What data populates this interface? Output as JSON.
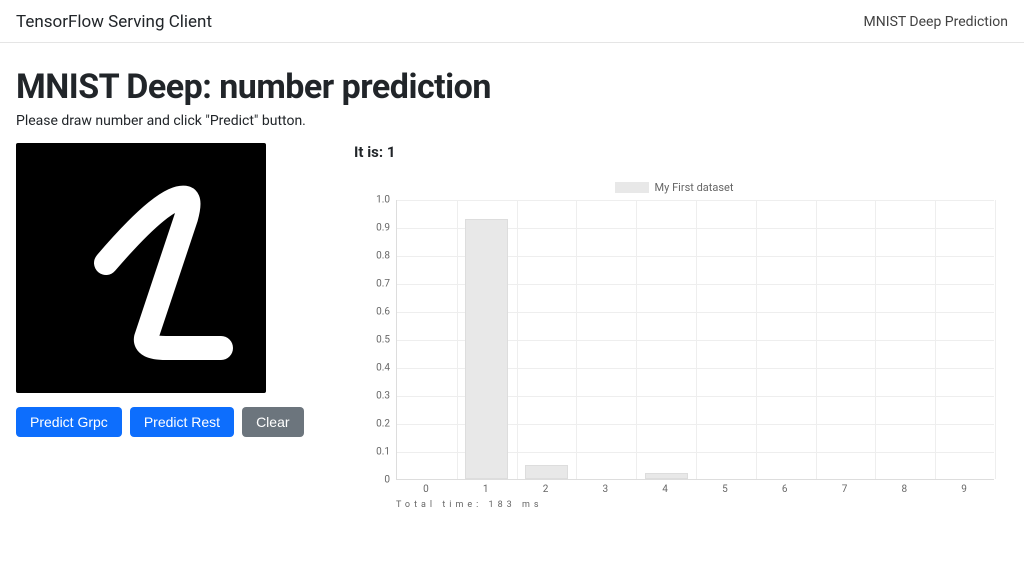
{
  "navbar": {
    "brand": "TensorFlow Serving Client",
    "right_link": "MNIST Deep Prediction"
  },
  "page": {
    "title": "MNIST Deep: number prediction",
    "instructions": "Please draw number and click \"Predict\" button."
  },
  "buttons": {
    "predict_grpc": "Predict Grpc",
    "predict_rest": "Predict Rest",
    "clear": "Clear"
  },
  "result": {
    "prefix": "It is: ",
    "value": "1"
  },
  "footnote": "Total time: 183 ms",
  "chart_data": {
    "type": "bar",
    "legend": "My First dataset",
    "categories": [
      "0",
      "1",
      "2",
      "3",
      "4",
      "5",
      "6",
      "7",
      "8",
      "9"
    ],
    "values": [
      0,
      0.93,
      0.05,
      0,
      0.02,
      0,
      0,
      0,
      0,
      0
    ],
    "ylim": [
      0,
      1.0
    ],
    "yticks": [
      0,
      0.1,
      0.2,
      0.3,
      0.4,
      0.5,
      0.6,
      0.7,
      0.8,
      0.9,
      1.0
    ],
    "title": "",
    "xlabel": "",
    "ylabel": ""
  }
}
